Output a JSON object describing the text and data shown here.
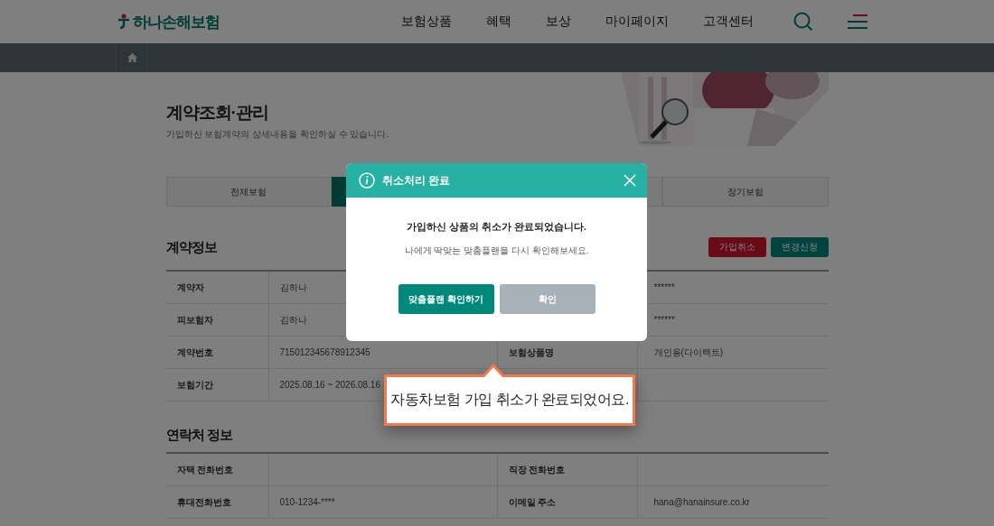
{
  "header": {
    "logo": "하나손해보험",
    "nav": [
      "보험상품",
      "혜택",
      "보상",
      "마이페이지",
      "고객센터"
    ]
  },
  "page": {
    "title": "계약조회·관리",
    "subtitle": "가입하신 보험계약의 상세내용을 확인하실 수 있습니다."
  },
  "tabs": [
    {
      "label": "전체보험",
      "selected": false
    },
    {
      "selected": true
    },
    {
      "selected": false
    },
    {
      "label": "장기보험",
      "selected": false
    }
  ],
  "contract": {
    "title": "계약정보",
    "buttons": [
      {
        "label": "가입취소",
        "kind": "danger"
      },
      {
        "label": "변경신청",
        "kind": "primary"
      }
    ],
    "rows": [
      [
        "계약자",
        "김하나",
        "",
        "******"
      ],
      [
        "피보험자",
        "김하나",
        "",
        "******"
      ],
      [
        "계약번호",
        "71501234567891234​5",
        "보험상품명",
        "개인용(다이렉트)"
      ],
      [
        "보험기간",
        "2025.08.16 ~ 2026.08.16",
        "",
        ""
      ]
    ]
  },
  "contact": {
    "title": "연락처 정보",
    "rows": [
      [
        "자택 전화번호",
        "",
        "직장 전화번호",
        ""
      ],
      [
        "휴대전화번호",
        "010-1234-****",
        "이메일 주소",
        "hana@hanainsure.co.kr"
      ]
    ]
  },
  "dialog": {
    "title": "취소처리 완료",
    "message": "가입하신 상품의 취소가 완료되었습니다.",
    "sub": "나에게 딱맞는 맞춤플랜을 다시 확인해보세요.",
    "buttons": [
      {
        "label": "맞춤플랜 확인하기",
        "kind": "primary"
      },
      {
        "label": "확인",
        "kind": "secondary"
      }
    ]
  },
  "callout": "자동차보험 가입 취소가 완료되었어요."
}
